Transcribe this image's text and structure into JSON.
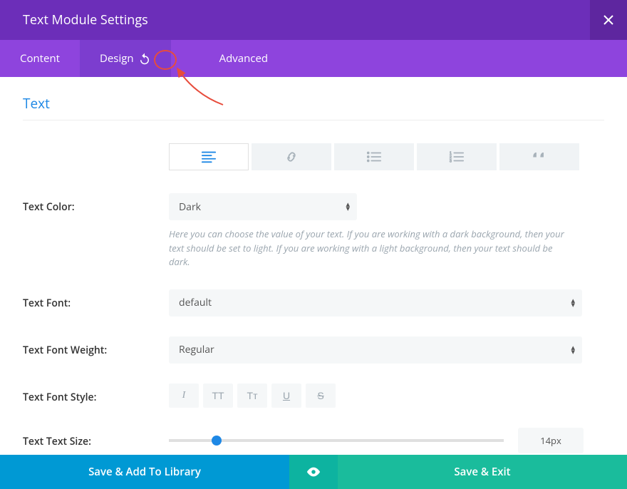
{
  "header": {
    "title": "Text Module Settings"
  },
  "tabs": {
    "content": "Content",
    "design": "Design",
    "advanced": "Advanced"
  },
  "section": {
    "title": "Text"
  },
  "fields": {
    "color": {
      "label": "Text Color:",
      "value": "Dark",
      "help": "Here you can choose the value of your text. If you are working with a dark background, then your text should be set to light. If you are working with a light background, then your text should be dark."
    },
    "font": {
      "label": "Text Font:",
      "value": "default"
    },
    "weight": {
      "label": "Text Font Weight:",
      "value": "Regular"
    },
    "style": {
      "label": "Text Font Style:"
    },
    "size": {
      "label": "Text Text Size:",
      "value": "14px"
    }
  },
  "styleButtons": {
    "italic": "I",
    "uppercase": "TT",
    "smallcaps": "Tᴛ",
    "underline": "U",
    "strikethrough": "S"
  },
  "footer": {
    "saveLib": "Save & Add To Library",
    "saveExit": "Save & Exit"
  }
}
